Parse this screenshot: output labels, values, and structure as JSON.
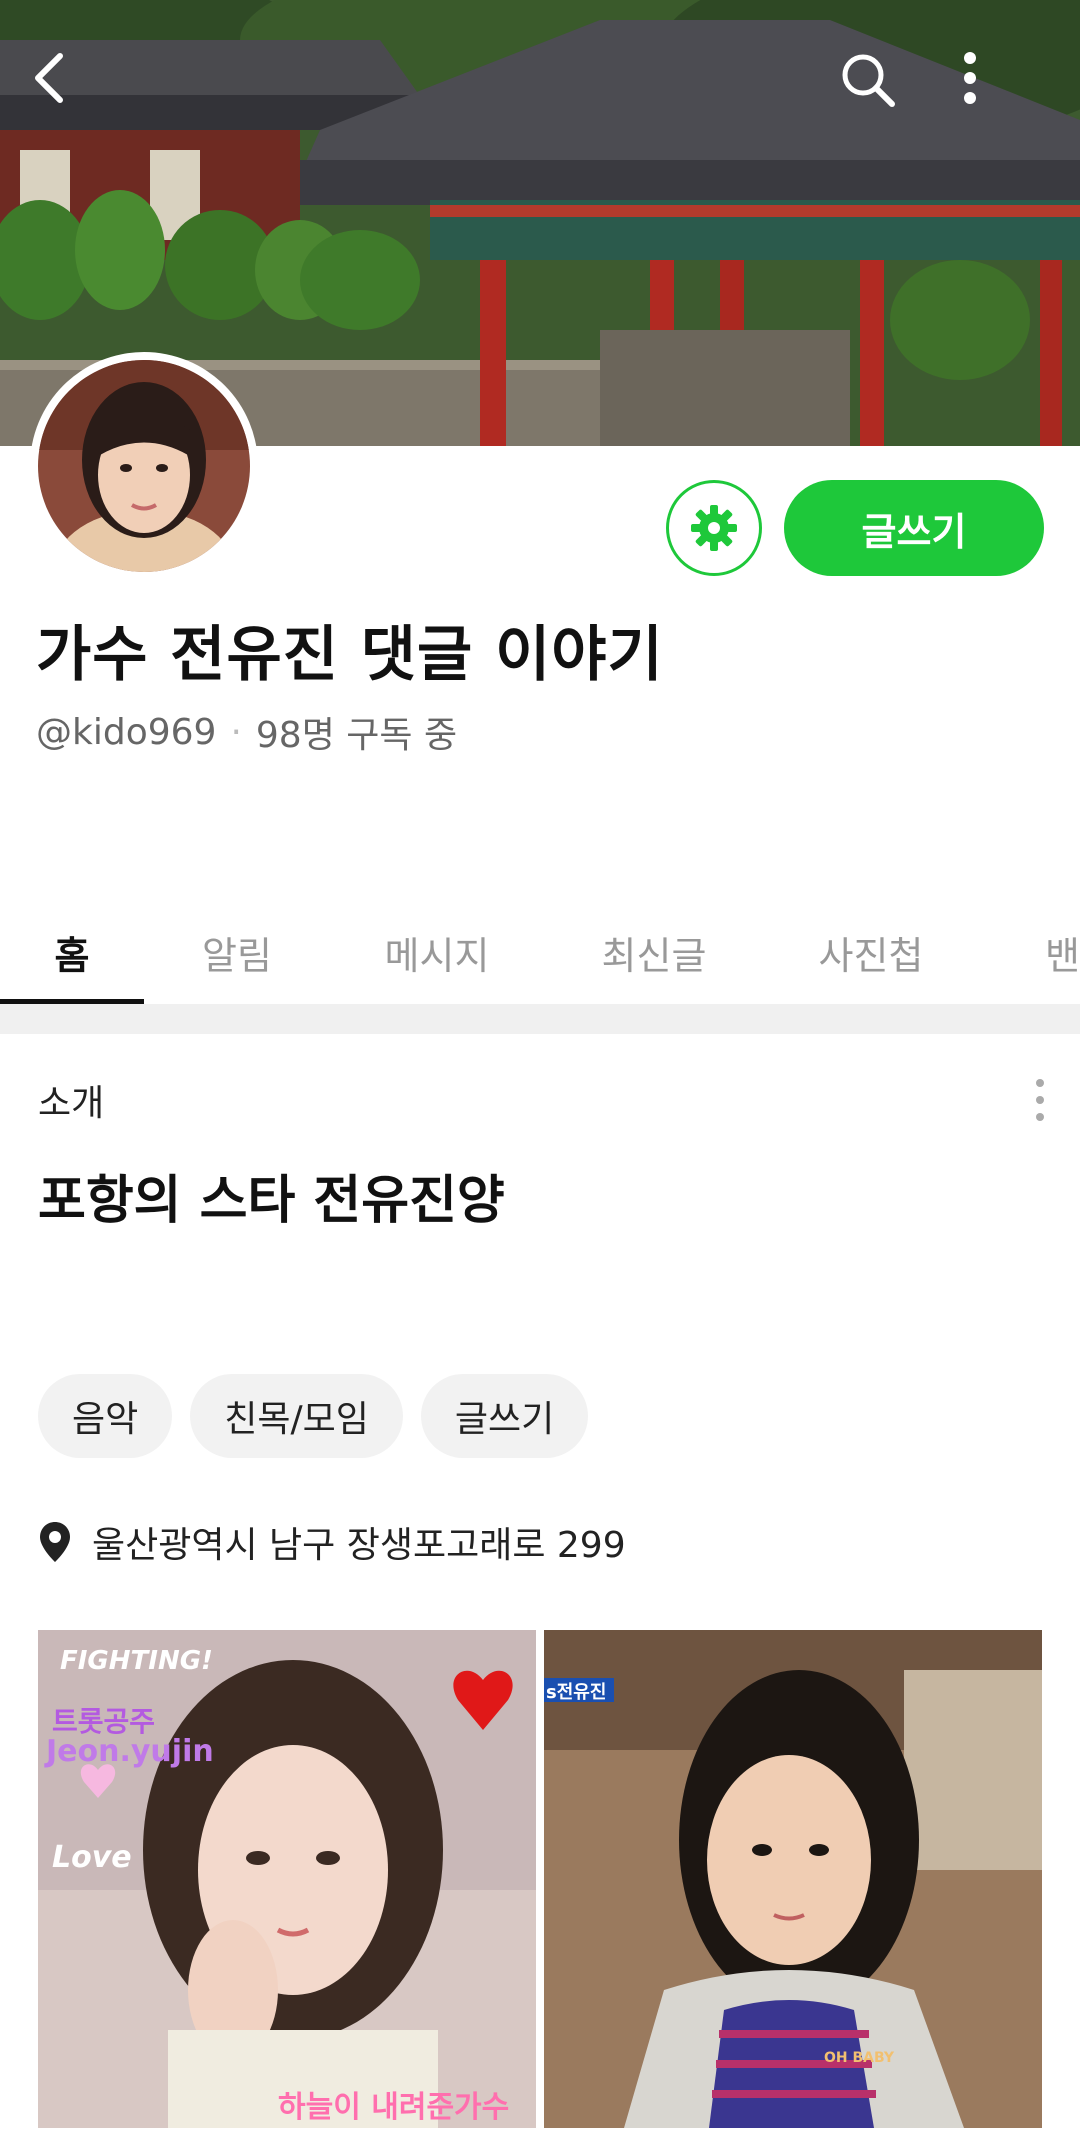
{
  "header": {
    "back_icon": "chevron-left-icon",
    "search_icon": "search-icon",
    "more_icon": "more-vertical-icon"
  },
  "profile": {
    "title": "가수 전유진 댓글 이야기",
    "handle": "@kido969",
    "subscribers": "98명 구독 중",
    "write_label": "글쓰기",
    "settings_icon": "gear-icon",
    "accent": "#1ec83a"
  },
  "tabs": [
    {
      "label": "홈"
    },
    {
      "label": "알림"
    },
    {
      "label": "메시지"
    },
    {
      "label": "최신글"
    },
    {
      "label": "사진첩"
    },
    {
      "label": "밴"
    }
  ],
  "intro": {
    "section_label": "소개",
    "text": "포항의 스타 전유진양"
  },
  "chips": [
    {
      "label": "음악"
    },
    {
      "label": "친목/모임"
    },
    {
      "label": "글쓰기"
    }
  ],
  "address": "울산광역시 남구 장생포고래로 299",
  "photos": [
    {
      "overlay_top": "FIGHTING!",
      "overlay_name_ko": "트롯공주",
      "overlay_name_en": "Jeon.yujin",
      "overlay_love": "Love",
      "overlay_bottom": "하늘이 내려준가수"
    },
    {
      "overlay_tag": "s전유진",
      "overlay_shirt": "OH BABY"
    }
  ]
}
